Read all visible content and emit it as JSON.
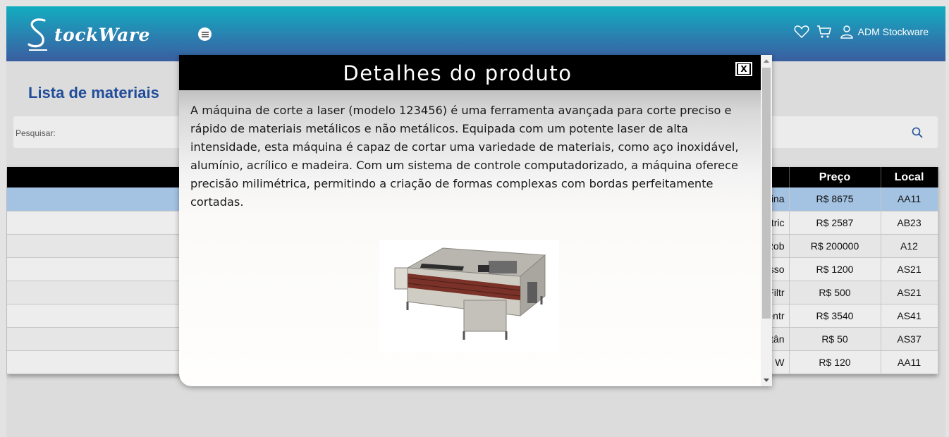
{
  "header": {
    "logo_text": "tockWare",
    "user_name": "ADM Stockware"
  },
  "page": {
    "title": "Lista de materiais"
  },
  "search": {
    "label": "Pesquisar:",
    "value": ""
  },
  "table": {
    "headers": {
      "nome": "",
      "preco": "Preço",
      "local": "Local"
    },
    "rows": [
      {
        "nome": "Máquina",
        "preco": "R$ 8675",
        "local": "AA11",
        "selected": true
      },
      {
        "nome": "Motor Elétric",
        "preco": "R$ 2587",
        "local": "AB23"
      },
      {
        "nome": "Célula Rob",
        "preco": "R$ 200000",
        "local": "A12"
      },
      {
        "nome": "Compresso",
        "preco": "R$ 1200",
        "local": "AS21"
      },
      {
        "nome": "Sistema de Filtr",
        "preco": "R$ 500",
        "local": "AS21"
      },
      {
        "nome": "Bomba Centr",
        "preco": "R$ 3540",
        "local": "AS41"
      },
      {
        "nome": "Sensor De Distân",
        "preco": "R$ 50",
        "local": "AS37"
      },
      {
        "nome": "SENSOR INDUTIVO W",
        "preco": "R$ 120",
        "local": "AA11"
      }
    ]
  },
  "modal": {
    "title": "Detalhes do produto",
    "close_label": "X",
    "description": "A máquina de corte a laser (modelo 123456) é uma ferramenta avançada para corte preciso e rápido de materiais metálicos e não metálicos. Equipada com um potente laser de alta intensidade, esta máquina é capaz de cortar uma variedade de materiais, como aço inoxidável, alumínio, acrílico e madeira. Com um sistema de controle computadorizado, a máquina oferece precisão milimétrica, permitindo a criação de formas complexas com bordas perfeitamente cortadas.",
    "scroll_fraction": 0.82
  },
  "icons": {
    "menu": "menu-icon",
    "favorites": "heart-icon",
    "cart": "cart-icon",
    "user": "user-icon",
    "search": "search-icon"
  },
  "colors": {
    "header_top": "#12adc0",
    "header_bottom": "#3a5ea0",
    "title": "#214d9a",
    "selected_row": "#a4c3e2"
  }
}
